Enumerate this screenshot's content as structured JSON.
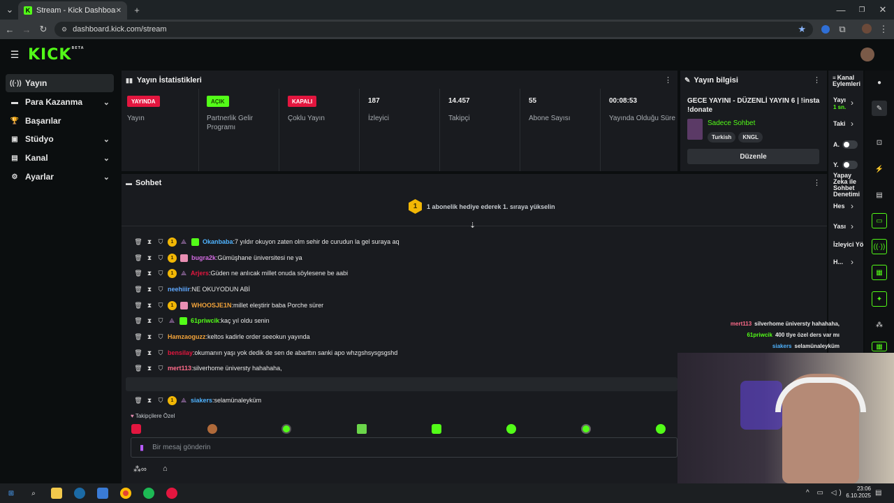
{
  "browser": {
    "tab_title": "Stream - Kick Dashboard",
    "url": "dashboard.kick.com/stream",
    "new_tab_glyph": "+",
    "tab_list_glyph": "⌄",
    "tab_close_glyph": "✕",
    "window_controls": {
      "minimize": "—",
      "restore": "❐",
      "close": "✕"
    },
    "nav": {
      "back": "←",
      "forward": "→",
      "reload": "↻",
      "menu": "⋮"
    }
  },
  "header": {
    "logo": "KICK",
    "logo_badge": "BETA",
    "hamburger": "☰"
  },
  "sidebar": {
    "items": [
      {
        "label": "Yayın",
        "icon": "broadcast-icon",
        "glyph": "((·))",
        "chevron": ""
      },
      {
        "label": "Para Kazanma",
        "icon": "money-icon",
        "glyph": "▬",
        "chevron": "⌄"
      },
      {
        "label": "Başarılar",
        "icon": "trophy-icon",
        "glyph": "🏆",
        "chevron": ""
      },
      {
        "label": "Stüdyo",
        "icon": "studio-icon",
        "glyph": "▣",
        "chevron": "⌄"
      },
      {
        "label": "Kanal",
        "icon": "channel-icon",
        "glyph": "▤",
        "chevron": "⌄"
      },
      {
        "label": "Ayarlar",
        "icon": "gear-icon",
        "glyph": "⚙",
        "chevron": "⌄"
      }
    ]
  },
  "stats": {
    "title": "Yayın İstatistikleri",
    "cells": [
      {
        "badge": "YAYINDA",
        "badge_color": "red",
        "label": "Yayın"
      },
      {
        "badge": "AÇIK",
        "badge_color": "green",
        "label": "Partnerlik Gelir Programı"
      },
      {
        "badge": "KAPALI",
        "badge_color": "red",
        "label": "Çoklu Yayın"
      },
      {
        "value": "187",
        "label": "İzleyici"
      },
      {
        "value": "14.457",
        "label": "Takipçi"
      },
      {
        "value": "55",
        "label": "Abone Sayısı"
      },
      {
        "value": "00:08:53",
        "label": "Yayında Olduğu Süre"
      }
    ]
  },
  "stream_info": {
    "title": "Yayın bilgisi",
    "stream_title": "GECE YAYINI - DÜZENLİ YAYIN 6 | !insta !donate",
    "category": "Sadece Sohbet",
    "tags": [
      "Turkish",
      "KNGL"
    ],
    "edit_button": "Düzenle"
  },
  "channel_actions": {
    "title": "Kanal Eylemleri",
    "items": [
      {
        "label": "Yayı",
        "sub": "1 sn.",
        "chevron": "›"
      },
      {
        "label": "Taki",
        "chevron": "›"
      },
      {
        "label": "A.",
        "toggle": true
      },
      {
        "label": "Y.",
        "toggle": true
      },
      {
        "label": "Yapay Zeka ile Sohbet Denetimi"
      },
      {
        "label": "Hes",
        "chevron": "›"
      },
      {
        "label": "Yası",
        "chevron": "›"
      },
      {
        "label": "İzleyici Yö"
      },
      {
        "label": "H...",
        "chevron": "›"
      }
    ]
  },
  "chat": {
    "title": "Sohbet",
    "promo_badge": "1",
    "promo_text": "1 abonelik hediye ederek 1. sıraya yükselin",
    "scroll_glyph": "⇣",
    "messages": [
      {
        "user": "Okanbaba",
        "color": "#4fb3ff",
        "text": "7 yıldır okuyon zaten olm sehir de curudun la gel suraya aq",
        "badges": [
          "gold",
          "tri",
          "green"
        ]
      },
      {
        "user": "bugra2k",
        "color": "#d46ce3",
        "text": "Gümüşhane üniversitesi ne ya",
        "badges": [
          "gold",
          "pink"
        ]
      },
      {
        "user": "Arjers",
        "color": "#e3163f",
        "text": "Güden ne anlıcak millet onuda söylesene be aabi",
        "badges": [
          "gold",
          "tri"
        ]
      },
      {
        "user": "neehiiir",
        "color": "#5fa8ff",
        "text": "NE OKUYODUN ABİ",
        "badges": []
      },
      {
        "user": "WHOOSJE1N",
        "color": "#f2a33a",
        "text": "millet eleştirir baba Porche sürer",
        "badges": [
          "gold",
          "pink"
        ]
      },
      {
        "user": "61priwcik",
        "color": "#53fc18",
        "text": "kaç yıl oldu senin",
        "badges": [
          "tri",
          "green"
        ]
      },
      {
        "user": "Hamzaoguzz",
        "color": "#f2a33a",
        "text": "keltos kadirle order seeokun yayında",
        "badges": []
      },
      {
        "user": "bensilay",
        "color": "#e3163f",
        "text": "okumanın yaşı yok dedik de sen de abarttın sanki apo whzgshsysgsgshd",
        "badges": []
      },
      {
        "user": "mert113",
        "color": "#ff6b8a",
        "text": "silverhome üniversty hahahaha,",
        "badges": []
      },
      {
        "user": "61priwcik",
        "color": "#53fc18",
        "text": "400 tlye özel ders var mı",
        "badges": [
          "tri",
          "green"
        ]
      },
      {
        "user": "siakers",
        "color": "#4fb3ff",
        "text": "selamünaleyküm",
        "badges": [
          "gold",
          "tri"
        ]
      }
    ],
    "emote_section": "Takipçilere Özel",
    "input_placeholder": "Bir mesaj gönderin",
    "points": "∞"
  },
  "overlay_chat": [
    {
      "user": "mert113",
      "color": "#ff6b8a",
      "text": "silverhome üniversty hahahaha,"
    },
    {
      "user": "61priwcik",
      "color": "#53fc18",
      "text": "400 tlye özel ders var mı"
    },
    {
      "user": "siakers",
      "color": "#4fb3ff",
      "text": "selamünaleyküm"
    }
  ],
  "taskbar": {
    "time": "23:06",
    "date": "6.10.2025"
  },
  "colors": {
    "accent": "#53fc18",
    "live_red": "#e3163f",
    "panel": "#191b1f",
    "background": "#0b0e0f"
  }
}
